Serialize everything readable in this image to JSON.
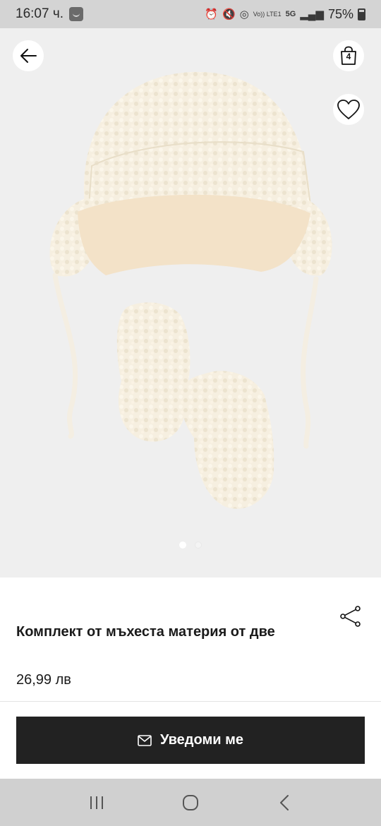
{
  "status_bar": {
    "time": "16:07 ч.",
    "network_label": "5G",
    "volte_label": "Vo)) LTE1",
    "battery": "75%"
  },
  "header": {
    "back_icon": "arrow-left-icon",
    "bag_count": "4",
    "bag_icon": "shopping-bag-icon",
    "favorite_icon": "heart-outline-icon"
  },
  "gallery": {
    "active_index": 1,
    "total": 2,
    "background_color": "#efefef"
  },
  "product": {
    "title": "Комплект от мъхеста материя от две",
    "price": "26,99 лв",
    "share_icon": "share-icon"
  },
  "actions": {
    "notify_label": "Уведоми ме",
    "notify_icon": "envelope-icon",
    "button_color": "#222222"
  },
  "system_nav": {
    "recents_icon": "recents-icon",
    "home_icon": "home-icon",
    "back_icon": "system-back-icon"
  }
}
